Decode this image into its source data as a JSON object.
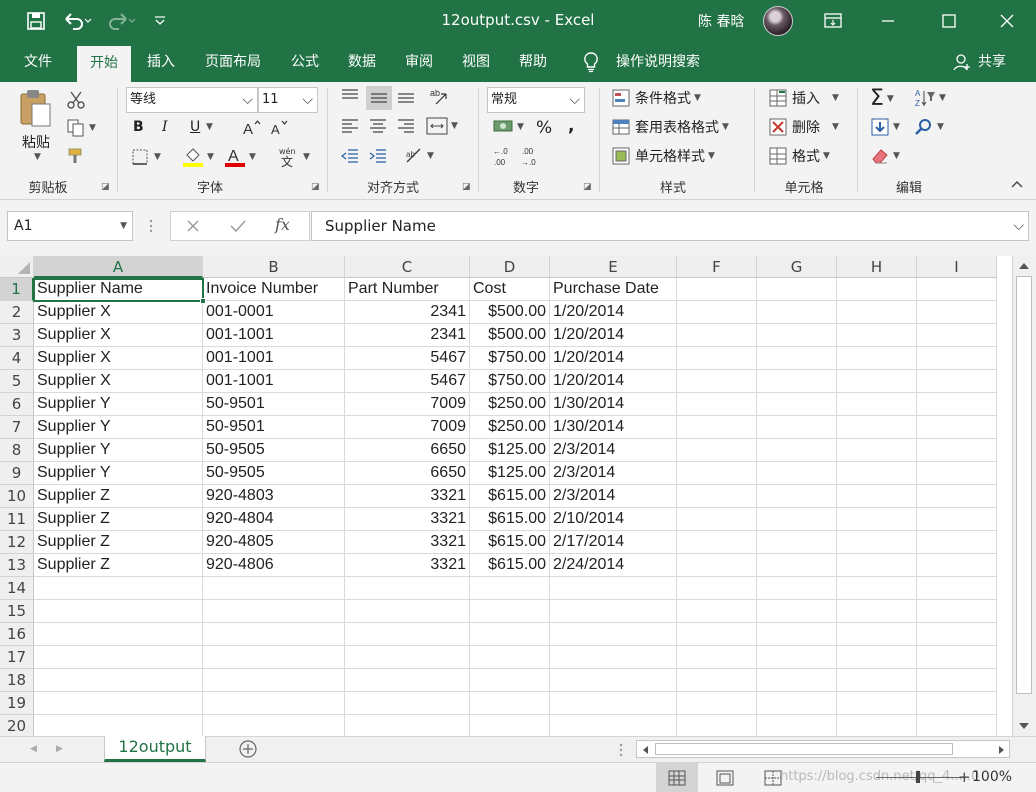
{
  "titlebar": {
    "title": "12output.csv  -  Excel",
    "user": "陈 春晗",
    "qat": {
      "save_icon": "save-icon",
      "undo_icon": "undo-icon",
      "redo_icon": "redo-icon",
      "customize_icon": "customize-icon"
    }
  },
  "tabs": [
    {
      "label": "文件"
    },
    {
      "label": "开始"
    },
    {
      "label": "插入"
    },
    {
      "label": "页面布局"
    },
    {
      "label": "公式"
    },
    {
      "label": "数据"
    },
    {
      "label": "审阅"
    },
    {
      "label": "视图"
    },
    {
      "label": "帮助"
    },
    {
      "label": "操作说明搜索"
    }
  ],
  "share": "共享",
  "ribbon": {
    "clipboard": {
      "paste": "粘贴",
      "label": "剪贴板"
    },
    "font": {
      "name": "等线",
      "size": "11",
      "bold": "B",
      "italic": "I",
      "underline": "U",
      "label": "字体",
      "pinyin": "wén"
    },
    "alignment": {
      "label": "对齐方式"
    },
    "number": {
      "format": "常规",
      "label": "数字"
    },
    "styles": {
      "conditional": "条件格式",
      "table": "套用表格格式",
      "cell": "单元格样式",
      "label": "样式"
    },
    "cells": {
      "insert": "插入",
      "delete": "删除",
      "format": "格式",
      "label": "单元格"
    },
    "editing": {
      "label": "编辑"
    }
  },
  "formula_bar": {
    "name_box": "A1",
    "fx": "fx",
    "value": "Supplier Name"
  },
  "columns": [
    "A",
    "B",
    "C",
    "D",
    "E",
    "F",
    "G",
    "H",
    "I"
  ],
  "rows": [
    "1",
    "2",
    "3",
    "4",
    "5",
    "6",
    "7",
    "8",
    "9",
    "10",
    "11",
    "12",
    "13",
    "14",
    "15",
    "16",
    "17",
    "18",
    "19",
    "20"
  ],
  "table": {
    "headers": [
      "Supplier Name",
      "Invoice Number",
      "Part Number",
      "Cost",
      "Purchase Date"
    ],
    "data": [
      [
        "Supplier X",
        "001-0001",
        "2341",
        "$500.00",
        "1/20/2014"
      ],
      [
        "Supplier X",
        "001-1001",
        "2341",
        "$500.00",
        "1/20/2014"
      ],
      [
        "Supplier X",
        "001-1001",
        "5467",
        "$750.00",
        "1/20/2014"
      ],
      [
        "Supplier X",
        "001-1001",
        "5467",
        "$750.00",
        "1/20/2014"
      ],
      [
        "Supplier Y",
        "50-9501",
        "7009",
        "$250.00",
        "1/30/2014"
      ],
      [
        "Supplier Y",
        "50-9501",
        "7009",
        "$250.00",
        "1/30/2014"
      ],
      [
        "Supplier Y",
        "50-9505",
        "6650",
        "$125.00",
        "2/3/2014"
      ],
      [
        "Supplier Y",
        "50-9505",
        "6650",
        "$125.00",
        "2/3/2014"
      ],
      [
        "Supplier Z",
        "920-4803",
        "3321",
        "$615.00",
        "2/3/2014"
      ],
      [
        "Supplier Z",
        "920-4804",
        "3321",
        "$615.00",
        "2/10/2014"
      ],
      [
        "Supplier Z",
        "920-4805",
        "3321",
        "$615.00",
        "2/17/2014"
      ],
      [
        "Supplier Z",
        "920-4806",
        "3321",
        "$615.00",
        "2/24/2014"
      ]
    ]
  },
  "sheet": {
    "tab": "12output"
  },
  "status": {
    "watermark": "https://blog.csdn.net/qq_4.....0",
    "zoom": "100%"
  },
  "colors": {
    "accent": "#217346",
    "ribbon_bg": "#f3f3f3"
  }
}
